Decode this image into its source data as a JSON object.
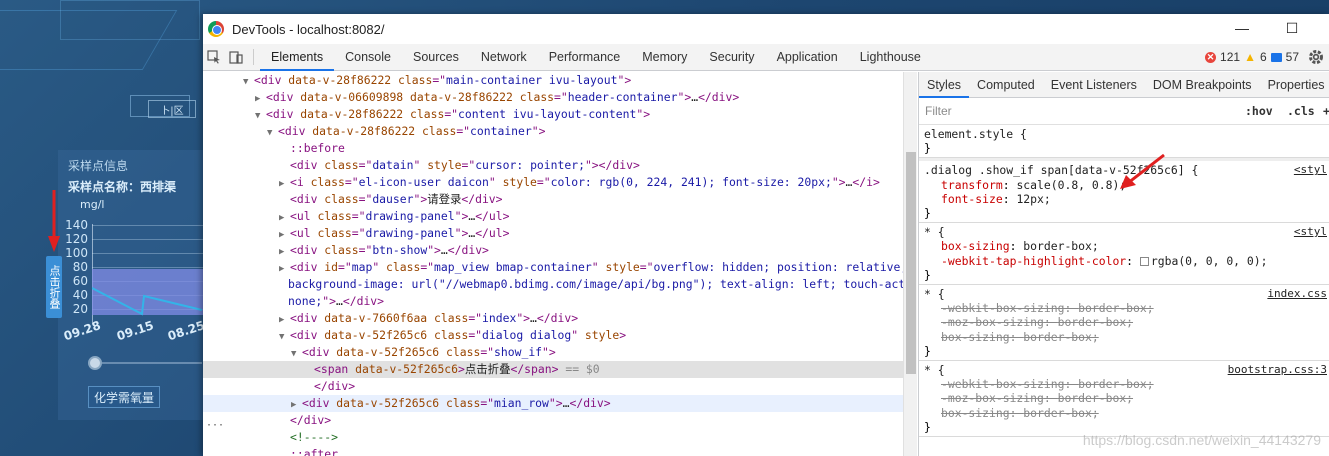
{
  "background_app": {
    "fold_tab_label": "点击折叠",
    "tab_button_label": "卜|区",
    "sample_info_title": "采样点信息",
    "sample_name": "采样点名称：西排渠",
    "unit": "mg/l",
    "y_ticks": [
      "140",
      "120",
      "100",
      "80",
      "60",
      "40",
      "20"
    ],
    "x_ticks": [
      "09.28",
      "09.15",
      "08.25"
    ],
    "cod_button_label": "化学需氧量"
  },
  "devtools": {
    "window_title": "DevTools - localhost:8082/",
    "window_controls": [
      "—",
      "☐"
    ],
    "tabs": [
      "Elements",
      "Console",
      "Sources",
      "Network",
      "Performance",
      "Memory",
      "Security",
      "Application",
      "Lighthouse"
    ],
    "active_tab": "Elements",
    "status": {
      "errors": "121",
      "warnings": "6",
      "messages": "57"
    },
    "colors": {
      "accent": "#1a73e8",
      "tag": "#881280",
      "attr": "#994500",
      "value": "#1a1aa6",
      "prop": "#c80000",
      "error": "#e8453c",
      "warning": "#f4b400",
      "info": "#1a73e8"
    },
    "elements": {
      "lines": [
        {
          "tri": "▼",
          "parts": [
            [
              "tag",
              "<div "
            ],
            [
              "attr",
              "data-v-28f86222 class"
            ],
            [
              "tag",
              "=\""
            ],
            [
              "val",
              "main-container ivu-layout"
            ],
            [
              "tag",
              "\">"
            ]
          ]
        },
        {
          "tri": "▶",
          "parts": [
            [
              "tag",
              "<div "
            ],
            [
              "attr",
              "data-v-06609898 data-v-28f86222 class"
            ],
            [
              "tag",
              "=\""
            ],
            [
              "val",
              "header-container"
            ],
            [
              "tag",
              "\">"
            ],
            [
              "txt",
              "…"
            ],
            [
              "tag",
              "</div>"
            ]
          ]
        },
        {
          "tri": "▼",
          "parts": [
            [
              "tag",
              "<div "
            ],
            [
              "attr",
              "data-v-28f86222 class"
            ],
            [
              "tag",
              "=\""
            ],
            [
              "val",
              "content ivu-layout-content"
            ],
            [
              "tag",
              "\">"
            ]
          ]
        },
        {
          "tri": "▼",
          "parts": [
            [
              "tag",
              "<div "
            ],
            [
              "attr",
              "data-v-28f86222 class"
            ],
            [
              "tag",
              "=\""
            ],
            [
              "val",
              "container"
            ],
            [
              "tag",
              "\">"
            ]
          ]
        },
        {
          "tri": "",
          "parts": [
            [
              "pseudo",
              "::before"
            ]
          ]
        },
        {
          "tri": "",
          "parts": [
            [
              "tag",
              "<div "
            ],
            [
              "attr",
              "class"
            ],
            [
              "tag",
              "=\""
            ],
            [
              "val",
              "datain"
            ],
            [
              "tag",
              "\" "
            ],
            [
              "attr",
              "style"
            ],
            [
              "tag",
              "=\""
            ],
            [
              "val",
              "cursor: pointer;"
            ],
            [
              "tag",
              "\"></div>"
            ]
          ]
        },
        {
          "tri": "▶",
          "parts": [
            [
              "tag",
              "<i "
            ],
            [
              "attr",
              "class"
            ],
            [
              "tag",
              "=\""
            ],
            [
              "val",
              "el-icon-user daicon"
            ],
            [
              "tag",
              "\" "
            ],
            [
              "attr",
              "style"
            ],
            [
              "tag",
              "=\""
            ],
            [
              "val",
              "color: rgb(0, 224, 241); font-size: 20px;"
            ],
            [
              "tag",
              "\">"
            ],
            [
              "txt",
              "…"
            ],
            [
              "tag",
              "</i>"
            ]
          ]
        },
        {
          "tri": "",
          "parts": [
            [
              "tag",
              "<div "
            ],
            [
              "attr",
              "class"
            ],
            [
              "tag",
              "=\""
            ],
            [
              "val",
              "dauser"
            ],
            [
              "tag",
              "\">"
            ],
            [
              "txt",
              "请登录"
            ],
            [
              "tag",
              "</div>"
            ]
          ]
        },
        {
          "tri": "▶",
          "parts": [
            [
              "tag",
              "<ul "
            ],
            [
              "attr",
              "class"
            ],
            [
              "tag",
              "=\""
            ],
            [
              "val",
              "drawing-panel"
            ],
            [
              "tag",
              "\">"
            ],
            [
              "txt",
              "…"
            ],
            [
              "tag",
              "</ul>"
            ]
          ]
        },
        {
          "tri": "▶",
          "parts": [
            [
              "tag",
              "<ul "
            ],
            [
              "attr",
              "class"
            ],
            [
              "tag",
              "=\""
            ],
            [
              "val",
              "drawing-panel"
            ],
            [
              "tag",
              "\">"
            ],
            [
              "txt",
              "…"
            ],
            [
              "tag",
              "</ul>"
            ]
          ]
        },
        {
          "tri": "▶",
          "parts": [
            [
              "tag",
              "<div "
            ],
            [
              "attr",
              "class"
            ],
            [
              "tag",
              "=\""
            ],
            [
              "val",
              "btn-show"
            ],
            [
              "tag",
              "\">"
            ],
            [
              "txt",
              "…"
            ],
            [
              "tag",
              "</div>"
            ]
          ]
        },
        {
          "tri": "▶",
          "parts": [
            [
              "tag",
              "<div "
            ],
            [
              "attr",
              "id"
            ],
            [
              "tag",
              "=\""
            ],
            [
              "val",
              "map"
            ],
            [
              "tag",
              "\" "
            ],
            [
              "attr",
              "class"
            ],
            [
              "tag",
              "=\""
            ],
            [
              "val",
              "map_view bmap-container"
            ],
            [
              "tag",
              "\" "
            ],
            [
              "attr",
              "style"
            ],
            [
              "tag",
              "=\""
            ],
            [
              "val",
              "overflow: hidden; position: relative;"
            ]
          ]
        },
        {
          "tri": "",
          "parts": [
            [
              "val",
              "background-image: url(\"//webmap0.bdimg.com/image/api/bg.png\"); text-align: left; touch-action:"
            ]
          ]
        },
        {
          "tri": "",
          "parts": [
            [
              "val",
              "none;"
            ],
            [
              "tag",
              "\">"
            ],
            [
              "txt",
              "…"
            ],
            [
              "tag",
              "</div>"
            ]
          ]
        },
        {
          "tri": "▶",
          "parts": [
            [
              "tag",
              "<div "
            ],
            [
              "attr",
              "data-v-7660f6aa class"
            ],
            [
              "tag",
              "=\""
            ],
            [
              "val",
              "index"
            ],
            [
              "tag",
              "\">"
            ],
            [
              "txt",
              "…"
            ],
            [
              "tag",
              "</div>"
            ]
          ]
        },
        {
          "tri": "▼",
          "parts": [
            [
              "tag",
              "<div "
            ],
            [
              "attr",
              "data-v-52f265c6 class"
            ],
            [
              "tag",
              "=\""
            ],
            [
              "val",
              "dialog dialog"
            ],
            [
              "tag",
              "\" "
            ],
            [
              "attr",
              "style"
            ],
            [
              "tag",
              ">"
            ]
          ]
        },
        {
          "tri": "▼",
          "parts": [
            [
              "tag",
              "<div "
            ],
            [
              "attr",
              "data-v-52f265c6 class"
            ],
            [
              "tag",
              "=\""
            ],
            [
              "val",
              "show_if"
            ],
            [
              "tag",
              "\">"
            ]
          ]
        },
        {
          "tri": "",
          "parts": [
            [
              "tag",
              "<span "
            ],
            [
              "attr",
              "data-v-52f265c6"
            ],
            [
              "tag",
              ">"
            ],
            [
              "txt",
              "点击折叠"
            ],
            [
              "tag",
              "</span>"
            ],
            [
              "txt",
              " == $0"
            ]
          ]
        },
        {
          "tri": "",
          "parts": [
            [
              "tag",
              "</div>"
            ]
          ]
        },
        {
          "tri": "▶",
          "parts": [
            [
              "tag",
              "<div "
            ],
            [
              "attr",
              "data-v-52f265c6 class"
            ],
            [
              "tag",
              "=\""
            ],
            [
              "val",
              "mian_row"
            ],
            [
              "tag",
              "\">"
            ],
            [
              "txt",
              "…"
            ],
            [
              "tag",
              "</div>"
            ]
          ]
        },
        {
          "tri": "",
          "parts": [
            [
              "tag",
              "</div>"
            ]
          ]
        },
        {
          "tri": "",
          "parts": [
            [
              "cmt",
              "<!---->"
            ]
          ]
        },
        {
          "tri": "",
          "parts": [
            [
              "pseudo",
              "::after"
            ]
          ]
        }
      ],
      "selected_suffix_label": "== $0",
      "row_ellipsis": "···"
    },
    "styles": {
      "tabs": [
        "Styles",
        "Computed",
        "Event Listeners",
        "DOM Breakpoints",
        "Properties"
      ],
      "active_tab": "Styles",
      "filter_placeholder": "Filter",
      "hov_label": ":hov",
      "cls_label": ".cls",
      "plus_label": "+",
      "rules": [
        {
          "selector": "element.style {",
          "source": "",
          "decls": [],
          "close": "}"
        },
        {
          "selector": ".dialog .show_if span[data-v-52f265c6] {",
          "source": "<styl",
          "decls": [
            {
              "name": "transform",
              "value": "scale(0.8, 0.8);",
              "struck": false
            },
            {
              "name": "font-size",
              "value": "12px;",
              "struck": false
            }
          ],
          "close": "}"
        },
        {
          "selector": "* {",
          "source": "<styl",
          "decls": [
            {
              "name": "box-sizing",
              "value": "border-box;",
              "struck": false
            },
            {
              "name": "-webkit-tap-highlight-color",
              "value": "rgba(0, 0, 0, 0);",
              "struck": false,
              "swatch": true
            }
          ],
          "close": "}"
        },
        {
          "selector": "* {",
          "source": "index.css",
          "decls": [
            {
              "name": "-webkit-box-sizing",
              "value": "border-box;",
              "struck": true
            },
            {
              "name": "-moz-box-sizing",
              "value": "border-box;",
              "struck": true
            },
            {
              "name": "box-sizing",
              "value": "border-box;",
              "struck": true
            }
          ],
          "close": "}"
        },
        {
          "selector": "* {",
          "source": "bootstrap.css:3",
          "decls": [
            {
              "name": "-webkit-box-sizing",
              "value": "border-box;",
              "struck": true
            },
            {
              "name": "-moz-box-sizing",
              "value": "border-box;",
              "struck": true
            },
            {
              "name": "box-sizing",
              "value": "border-box;",
              "struck": true
            }
          ],
          "close": "}"
        }
      ],
      "watermark": "https://blog.csdn.net/weixin_44143279"
    }
  }
}
